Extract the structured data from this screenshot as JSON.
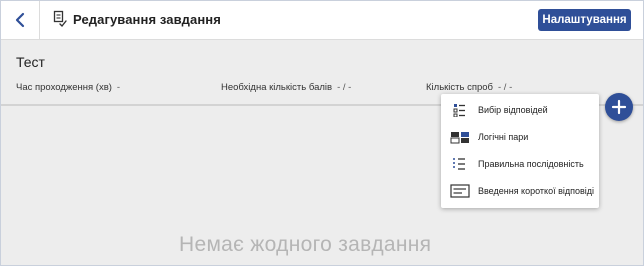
{
  "header": {
    "title": "Редагування завдання",
    "settings_label": "Налаштування"
  },
  "test": {
    "name": "Тест",
    "fields": [
      {
        "label": "Час проходження (хв)",
        "value": "-"
      },
      {
        "label": "Необхідна кількість балів",
        "value": "- / -"
      },
      {
        "label": "Кількість спроб",
        "value": "- / -"
      }
    ]
  },
  "empty_state": "Немає жодного завдання",
  "add_menu": {
    "items": [
      {
        "label": "Вибір відповідей",
        "icon": "multiple-choice-icon"
      },
      {
        "label": "Логічні пари",
        "icon": "logical-pairs-icon"
      },
      {
        "label": "Правильна послідовність",
        "icon": "sequence-icon"
      },
      {
        "label": "Введення короткої відповіді",
        "icon": "short-answer-icon"
      }
    ]
  },
  "colors": {
    "accent": "#2f4f98",
    "background": "#ededed",
    "empty_text": "#b5b5b5"
  }
}
